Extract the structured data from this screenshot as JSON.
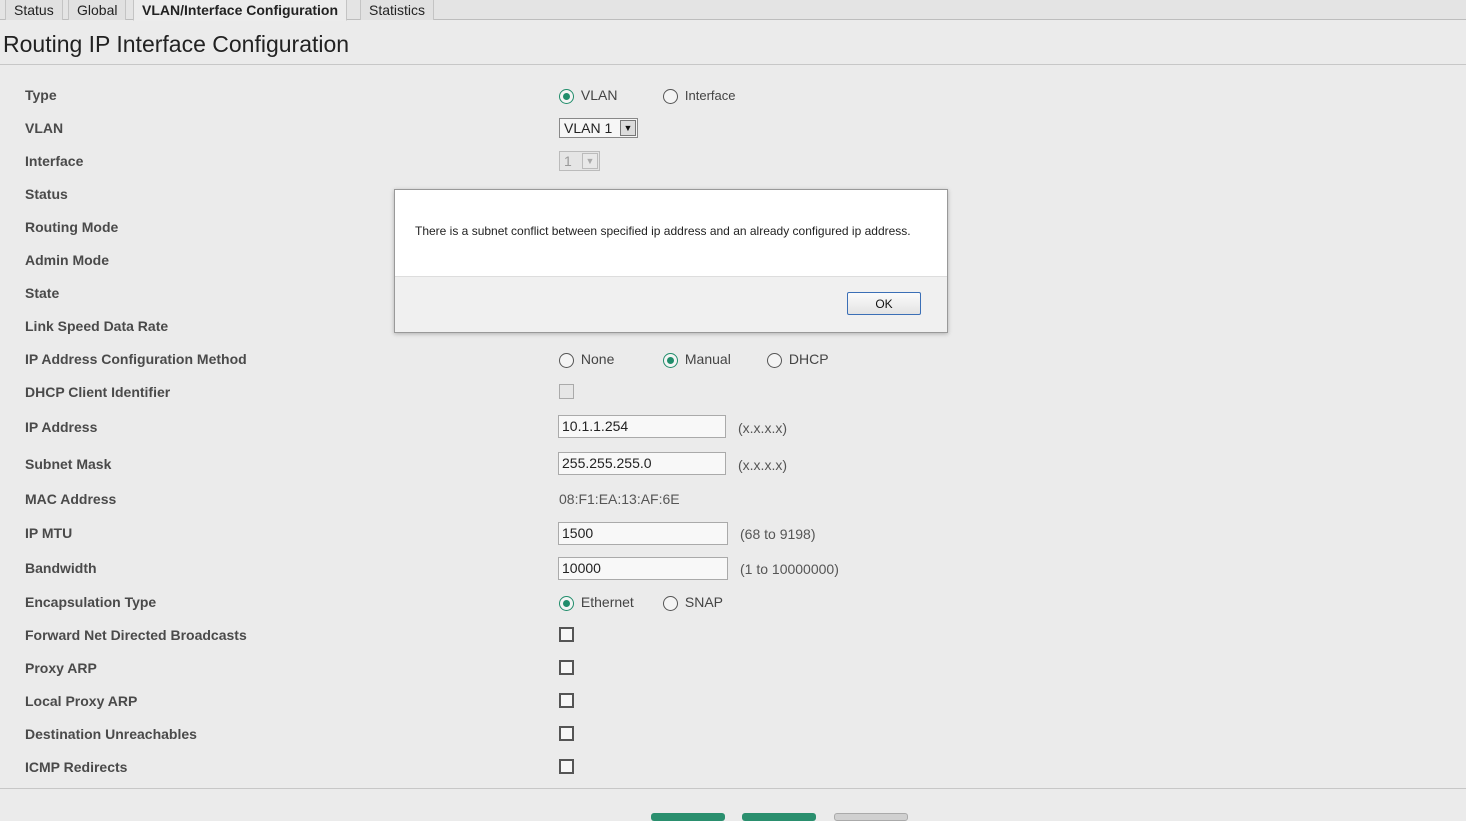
{
  "tabs": [
    {
      "label": "Status"
    },
    {
      "label": "Global"
    },
    {
      "label": "VLAN/Interface Configuration"
    },
    {
      "label": "Statistics"
    }
  ],
  "page_title": "Routing IP Interface Configuration",
  "fields": {
    "type": {
      "label": "Type",
      "options": [
        "VLAN",
        "Interface"
      ],
      "selected": "VLAN"
    },
    "vlan": {
      "label": "VLAN",
      "value": "VLAN 1"
    },
    "interface": {
      "label": "Interface",
      "value": "1"
    },
    "status": {
      "label": "Status"
    },
    "routing_mode": {
      "label": "Routing Mode"
    },
    "admin_mode": {
      "label": "Admin Mode"
    },
    "state": {
      "label": "State"
    },
    "link_speed": {
      "label": "Link Speed Data Rate"
    },
    "ip_method": {
      "label": "IP Address Configuration Method",
      "options": [
        "None",
        "Manual",
        "DHCP"
      ],
      "selected": "Manual"
    },
    "dhcp_client_id": {
      "label": "DHCP Client Identifier"
    },
    "ip_address": {
      "label": "IP Address",
      "value": "10.1.1.254",
      "hint": "(x.x.x.x)"
    },
    "subnet_mask": {
      "label": "Subnet Mask",
      "value": "255.255.255.0",
      "hint": "(x.x.x.x)"
    },
    "mac_address": {
      "label": "MAC Address",
      "value": "08:F1:EA:13:AF:6E"
    },
    "ip_mtu": {
      "label": "IP MTU",
      "value": "1500",
      "hint": "(68 to 9198)"
    },
    "bandwidth": {
      "label": "Bandwidth",
      "value": "10000",
      "hint": "(1 to 10000000)"
    },
    "encapsulation": {
      "label": "Encapsulation Type",
      "options": [
        "Ethernet",
        "SNAP"
      ],
      "selected": "Ethernet"
    },
    "fwd_net_directed": {
      "label": "Forward Net Directed Broadcasts"
    },
    "proxy_arp": {
      "label": "Proxy ARP"
    },
    "local_proxy_arp": {
      "label": "Local Proxy ARP"
    },
    "dest_unreachables": {
      "label": "Destination Unreachables"
    },
    "icmp_redirects": {
      "label": "ICMP Redirects"
    }
  },
  "dialog": {
    "message": "There is a subnet conflict between specified ip address and an already configured ip address.",
    "ok_label": "OK"
  },
  "colors": {
    "accent": "#218d6b",
    "dialog_button_border": "#3b6fb6"
  }
}
